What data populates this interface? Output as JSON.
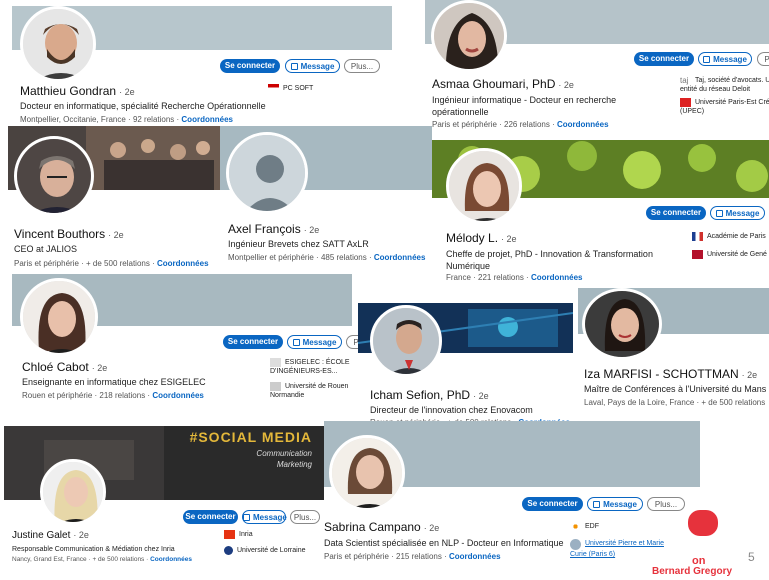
{
  "ui": {
    "connect": "Se connecter",
    "message": "Message",
    "more": "Plus...",
    "more_short": "P",
    "more_cut": "Pl"
  },
  "profiles": [
    {
      "name": "Matthieu Gondran",
      "degree": "2e",
      "headline": "Docteur en informatique, spécialité Recherche Opérationnelle",
      "location": "Montpellier, Occitanie, France",
      "relations": "92 relations",
      "coord": "Coordonnées",
      "orgs": [
        "PC SOFT"
      ]
    },
    {
      "name": "Asmaa Ghoumari, PhD",
      "degree": "2e",
      "headline": "Ingénieur informatique - Docteur en recherche opérationnelle",
      "location": "Paris et périphérie",
      "relations": "226 relations",
      "coord": "Coordonnées",
      "orgs": [
        "Taj, société d'avocats. U entité du réseau Deloit",
        "Université Paris-Est Cré (UPEC)"
      ]
    },
    {
      "name": "Vincent Bouthors",
      "degree": "2e",
      "headline": "CEO at JALIOS",
      "location": "Paris et périphérie",
      "relations": "+ de 500 relations",
      "coord": "Coordonnées"
    },
    {
      "name": "Axel François",
      "degree": "2e",
      "headline": "Ingénieur Brevets chez SATT AxLR",
      "location": "Montpellier et périphérie",
      "relations": "485 relations",
      "coord": "Coordonnées"
    },
    {
      "name": "Mélody L.",
      "degree": "2e",
      "headline": "Cheffe de projet, PhD - Innovation & Transformation Numérique",
      "location": "France",
      "relations": "221 relations",
      "coord": "Coordonnées",
      "orgs": [
        "Académie de Paris",
        "Université de Gené"
      ]
    },
    {
      "name": "Chloé Cabot",
      "degree": "2e",
      "headline": "Enseignante en informatique chez ESIGELEC",
      "location": "Rouen et périphérie",
      "relations": "218 relations",
      "coord": "Coordonnées",
      "orgs": [
        "ESIGELEC : ÉCOLE D'INGÉNIEURS-ES...",
        "Université de Rouen Normandie"
      ]
    },
    {
      "name": "Icham Sefion, PhD",
      "degree": "2e",
      "headline": "Directeur de l'innovation chez Enovacom",
      "location": "Rouen et périphérie",
      "relations": "+ de 500 relations",
      "coord": "Coordonnées"
    },
    {
      "name": "Iza MARFISI - SCHOTTMAN",
      "degree": "2e",
      "headline": "Maître de Conférences à l'Université du Mans",
      "location": "Laval, Pays de la Loire, France",
      "relations": "+ de 500 relations",
      "coord": ""
    },
    {
      "name": "Justine Galet",
      "degree": "2e",
      "headline": "Responsable Communication & Médiation chez Inria",
      "location": "Nancy, Grand Est, France",
      "relations": "+ de 500 relations",
      "coord": "Coordonnées",
      "orgs": [
        "Inria",
        "Université de Lorraine"
      ],
      "banner_title": "#SOCIAL MEDIA",
      "banner_sub": "Communication Marketing"
    },
    {
      "name": "Sabrina Campano",
      "degree": "2e",
      "headline": "Data Scientist spécialisée en NLP - Docteur en Informatique",
      "location": "Paris et périphérie",
      "relations": "215 relations",
      "coord": "Coordonnées",
      "orgs": [
        "EDF",
        "Université Pierre et Marie Curie (Paris 6)"
      ]
    }
  ],
  "slide_number": "5",
  "brand": {
    "line1": "on",
    "line2": "Bernard Gregory"
  },
  "colors": {
    "accent": "#0a66c2",
    "banner": "#a9bcc4",
    "brand_red": "#e6323c"
  }
}
